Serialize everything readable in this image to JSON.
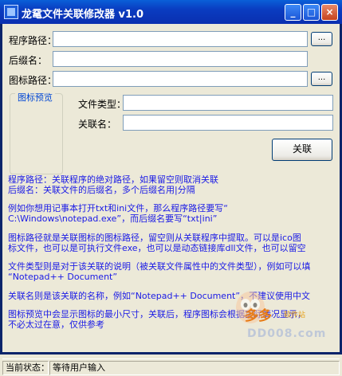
{
  "window": {
    "title": "龙鼋文件关联修改器 v1.0",
    "controls": {
      "minimize": "_",
      "maximize": "□",
      "close": "×"
    }
  },
  "form": {
    "program_path_label": "程序路径：",
    "program_path_value": "",
    "extension_label": "后缀名：",
    "extension_value": "",
    "icon_path_label": "图标路径：",
    "icon_path_value": "",
    "browse_label": "...",
    "preview_title": "图标预览",
    "file_type_label": "文件类型：",
    "file_type_value": "",
    "assoc_name_label": "关联名：",
    "assoc_name_value": "",
    "associate_button": "关联"
  },
  "help": {
    "lines": [
      "程序路径：关联程序的绝对路径，如果留空则取消关联",
      "后缀名：关联文件的后缀名，多个后缀名用|分隔",
      "例如你想用记事本打开txt和ini文件，那么程序路径要写“",
      "C:\\Windows\\notepad.exe”，而后缀名要写“txt|ini”",
      "图标路径就是关联图标的图标路径，留空则从关联程序中提取。可以是ico图",
      "标文件，也可以是可执行文件exe，也可以是动态链接库dll文件，也可以留空",
      "文件类型则是对于该关联的说明（被关联文件属性中的文件类型），例如可以填",
      "“Notepad++ Document”",
      "关联名则是该关联的名称，例如“Notepad++ Document”，不建议使用中文",
      "图标预览中会显示图标的最小尺寸，关联后，程序图标会根据实际情况显示，",
      "不必太过在意，仅供参考"
    ]
  },
  "watermark": {
    "brand": "多多",
    "sub": "软件站",
    "url": "DD008.com"
  },
  "status": {
    "label": "当前状态：",
    "value": "等待用户输入"
  },
  "colors": {
    "help_text": "#1a1ae6",
    "title_bar": "#0a3cc0",
    "background": "#ece9d8"
  }
}
